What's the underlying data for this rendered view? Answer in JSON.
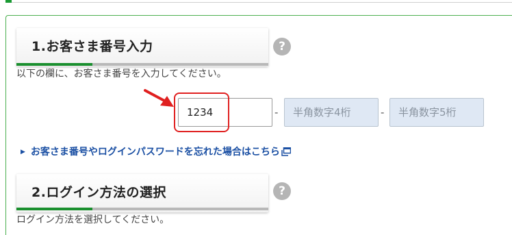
{
  "section1": {
    "title": "1.お客さま番号入力",
    "help": "?",
    "instruction": "以下の欄に、お客さま番号を入力してください。",
    "field1_value": "1234",
    "field2_placeholder": "半角数字4桁",
    "field3_placeholder": "半角数字5桁",
    "separator": "-",
    "forgot_link": "お客さま番号やログインパスワードを忘れた場合はこちら"
  },
  "section2": {
    "title": "2.ログイン方法の選択",
    "help": "?",
    "instruction": "ログイン方法を選択してください。"
  },
  "colors": {
    "accent_green": "#1a8f2e",
    "link_blue": "#1a4fa3",
    "highlight_red": "#e02020",
    "input_bg": "#dfe8f4"
  },
  "icons": [
    "help-icon",
    "red-arrow-icon",
    "triangle-right-icon",
    "external-window-icon"
  ]
}
